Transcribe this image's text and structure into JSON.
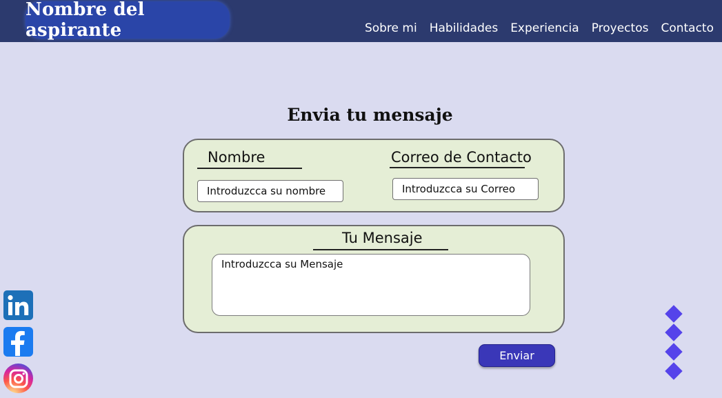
{
  "header": {
    "logo_text": "Nombre del aspirante",
    "nav": [
      "Sobre mi",
      "Habilidades",
      "Experiencia",
      "Proyectos",
      "Contacto"
    ]
  },
  "form": {
    "title": "Envia tu mensaje",
    "name_label": "Nombre",
    "name_value": "Introduzcca su nombre",
    "email_label": "Correo de Contacto",
    "email_value": "Introduzcca su Correo",
    "message_label": "Tu Mensaje",
    "message_value": "Introduzcca su Mensaje",
    "send_label": "Enviar"
  },
  "social": {
    "icons": [
      "linkedin-icon",
      "facebook-icon",
      "instagram-icon"
    ]
  },
  "colors": {
    "background": "#dadbf0",
    "header": "#2c3a6e",
    "logo": "#2a45a8",
    "panel": "#e5eed6",
    "button": "#3a37b8",
    "diamond": "#5543ea"
  }
}
